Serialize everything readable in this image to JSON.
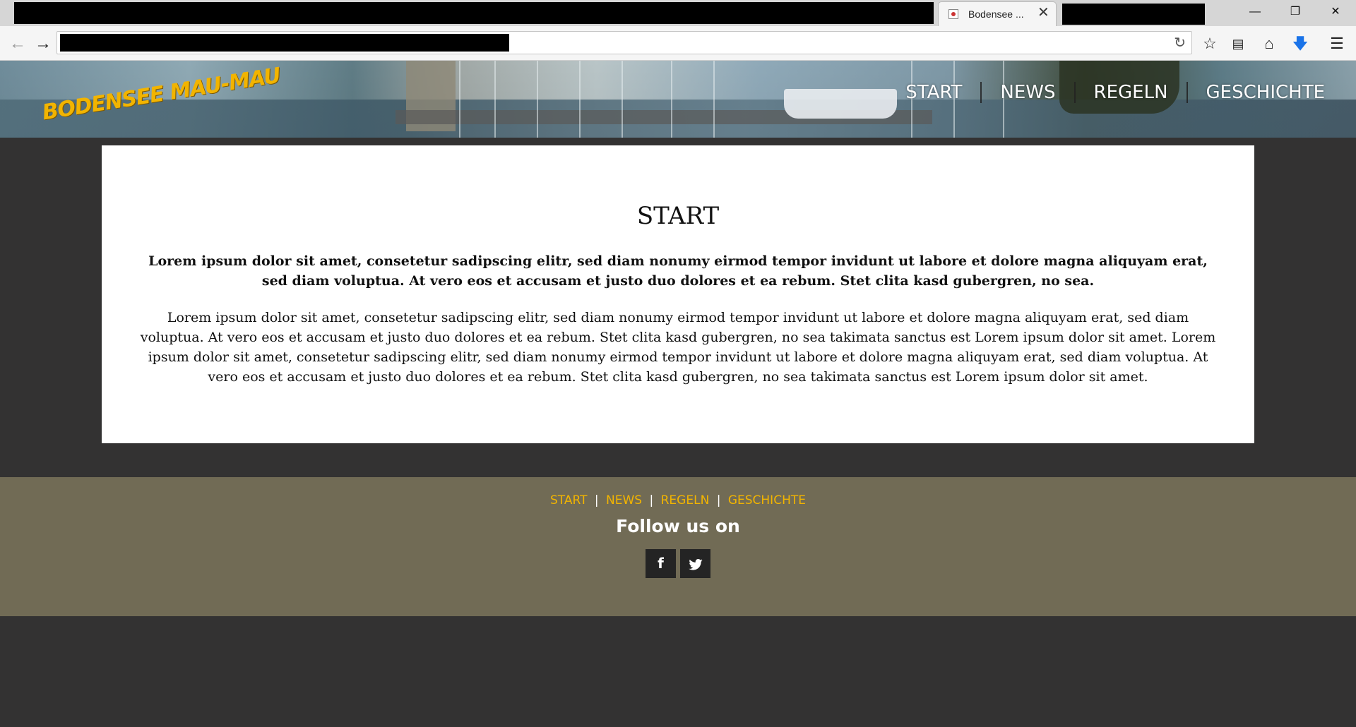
{
  "browser": {
    "tab_title": "Bodensee ...",
    "tab_close": "✕",
    "window_controls": {
      "minimize": "—",
      "restore": "❐",
      "close": "✕"
    },
    "icons": [
      "back-arrow-icon",
      "forward-arrow-icon",
      "reload-icon",
      "bookmark-star-icon",
      "reading-list-icon",
      "home-icon",
      "download-icon",
      "menu-icon"
    ]
  },
  "site": {
    "logo": "BODENSEE MAU-MAU",
    "menu": [
      "START",
      "NEWS",
      "REGELN",
      "GESCHICHTE"
    ]
  },
  "main": {
    "title": "START",
    "lead": "Lorem ipsum dolor sit amet, consetetur sadipscing elitr, sed diam nonumy eirmod tempor invidunt ut labore et dolore magna aliquyam erat, sed diam voluptua. At vero eos et accusam et justo duo dolores et ea rebum. Stet clita kasd gubergren, no sea.",
    "body": "Lorem ipsum dolor sit amet, consetetur sadipscing elitr, sed diam nonumy eirmod tempor invidunt ut labore et dolore magna aliquyam erat, sed diam voluptua. At vero eos et accusam et justo duo dolores et ea rebum. Stet clita kasd gubergren, no sea takimata sanctus est Lorem ipsum dolor sit amet. Lorem ipsum dolor sit amet, consetetur sadipscing elitr, sed diam nonumy eirmod tempor invidunt ut labore et dolore magna aliquyam erat, sed diam voluptua. At vero eos et accusam et justo duo dolores et ea rebum. Stet clita kasd gubergren, no sea takimata sanctus est Lorem ipsum dolor sit amet."
  },
  "footer": {
    "links": [
      "START",
      "NEWS",
      "REGELN",
      "GESCHICHTE"
    ],
    "separator": "|",
    "follow": "Follow us on",
    "social": {
      "facebook": "f",
      "twitter": "🐦"
    }
  },
  "colors": {
    "accent": "#f2b400",
    "page_bg": "#333232",
    "footer_bg": "#716b55",
    "card_bg": "#ffffff"
  }
}
